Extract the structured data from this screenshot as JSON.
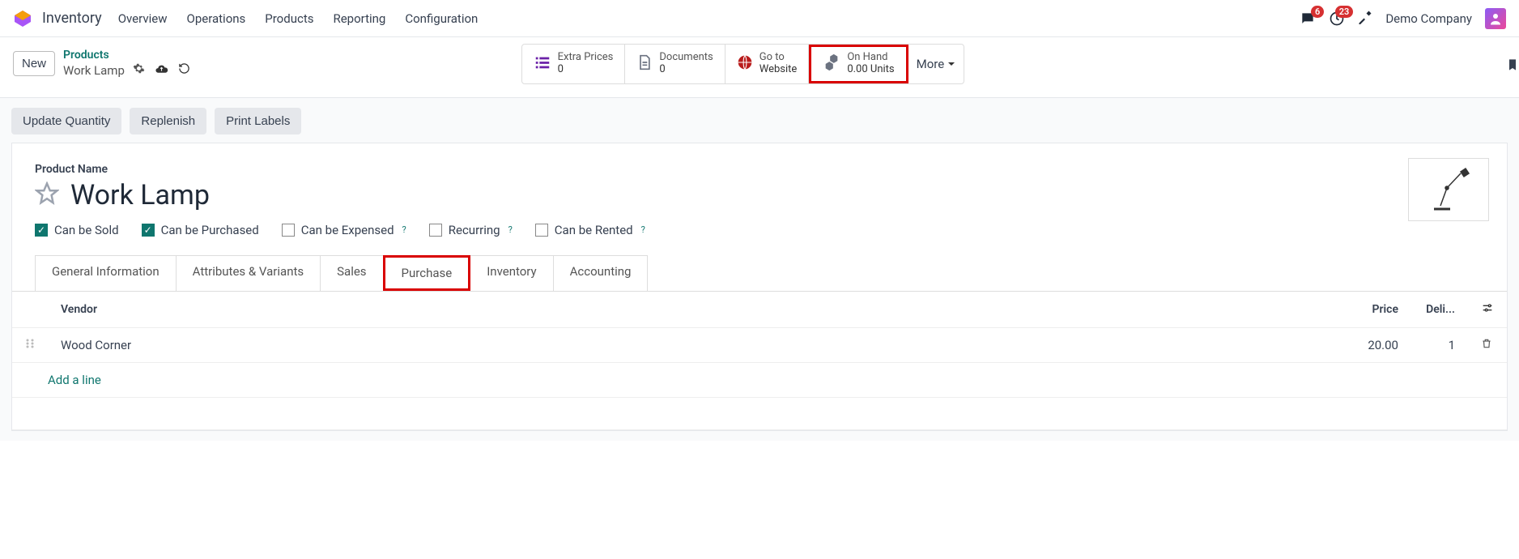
{
  "nav": {
    "app": "Inventory",
    "links": [
      "Overview",
      "Operations",
      "Products",
      "Reporting",
      "Configuration"
    ],
    "messages_badge": "6",
    "activities_badge": "23",
    "company": "Demo Company"
  },
  "breadcrumb": {
    "new_label": "New",
    "parent": "Products",
    "current": "Work Lamp"
  },
  "stat_buttons": {
    "extra_prices": {
      "label": "Extra Prices",
      "value": "0"
    },
    "documents": {
      "label": "Documents",
      "value": "0"
    },
    "website": {
      "label1": "Go to",
      "label2": "Website"
    },
    "on_hand": {
      "label": "On Hand",
      "value": "0.00 Units"
    },
    "more": "More"
  },
  "actions": {
    "update_qty": "Update Quantity",
    "replenish": "Replenish",
    "print_labels": "Print Labels"
  },
  "product": {
    "name_label": "Product Name",
    "name": "Work Lamp",
    "options": {
      "sold": {
        "label": "Can be Sold",
        "checked": true
      },
      "purchased": {
        "label": "Can be Purchased",
        "checked": true
      },
      "expensed": {
        "label": "Can be Expensed",
        "checked": false
      },
      "recurring": {
        "label": "Recurring",
        "checked": false
      },
      "rented": {
        "label": "Can be Rented",
        "checked": false
      }
    }
  },
  "tabs": [
    "General Information",
    "Attributes & Variants",
    "Sales",
    "Purchase",
    "Inventory",
    "Accounting"
  ],
  "active_tab": "Purchase",
  "vendor_table": {
    "headers": {
      "vendor": "Vendor",
      "price": "Price",
      "delivery": "Deli..."
    },
    "rows": [
      {
        "vendor": "Wood Corner",
        "price": "20.00",
        "delivery": "1"
      }
    ],
    "add_line": "Add a line"
  }
}
